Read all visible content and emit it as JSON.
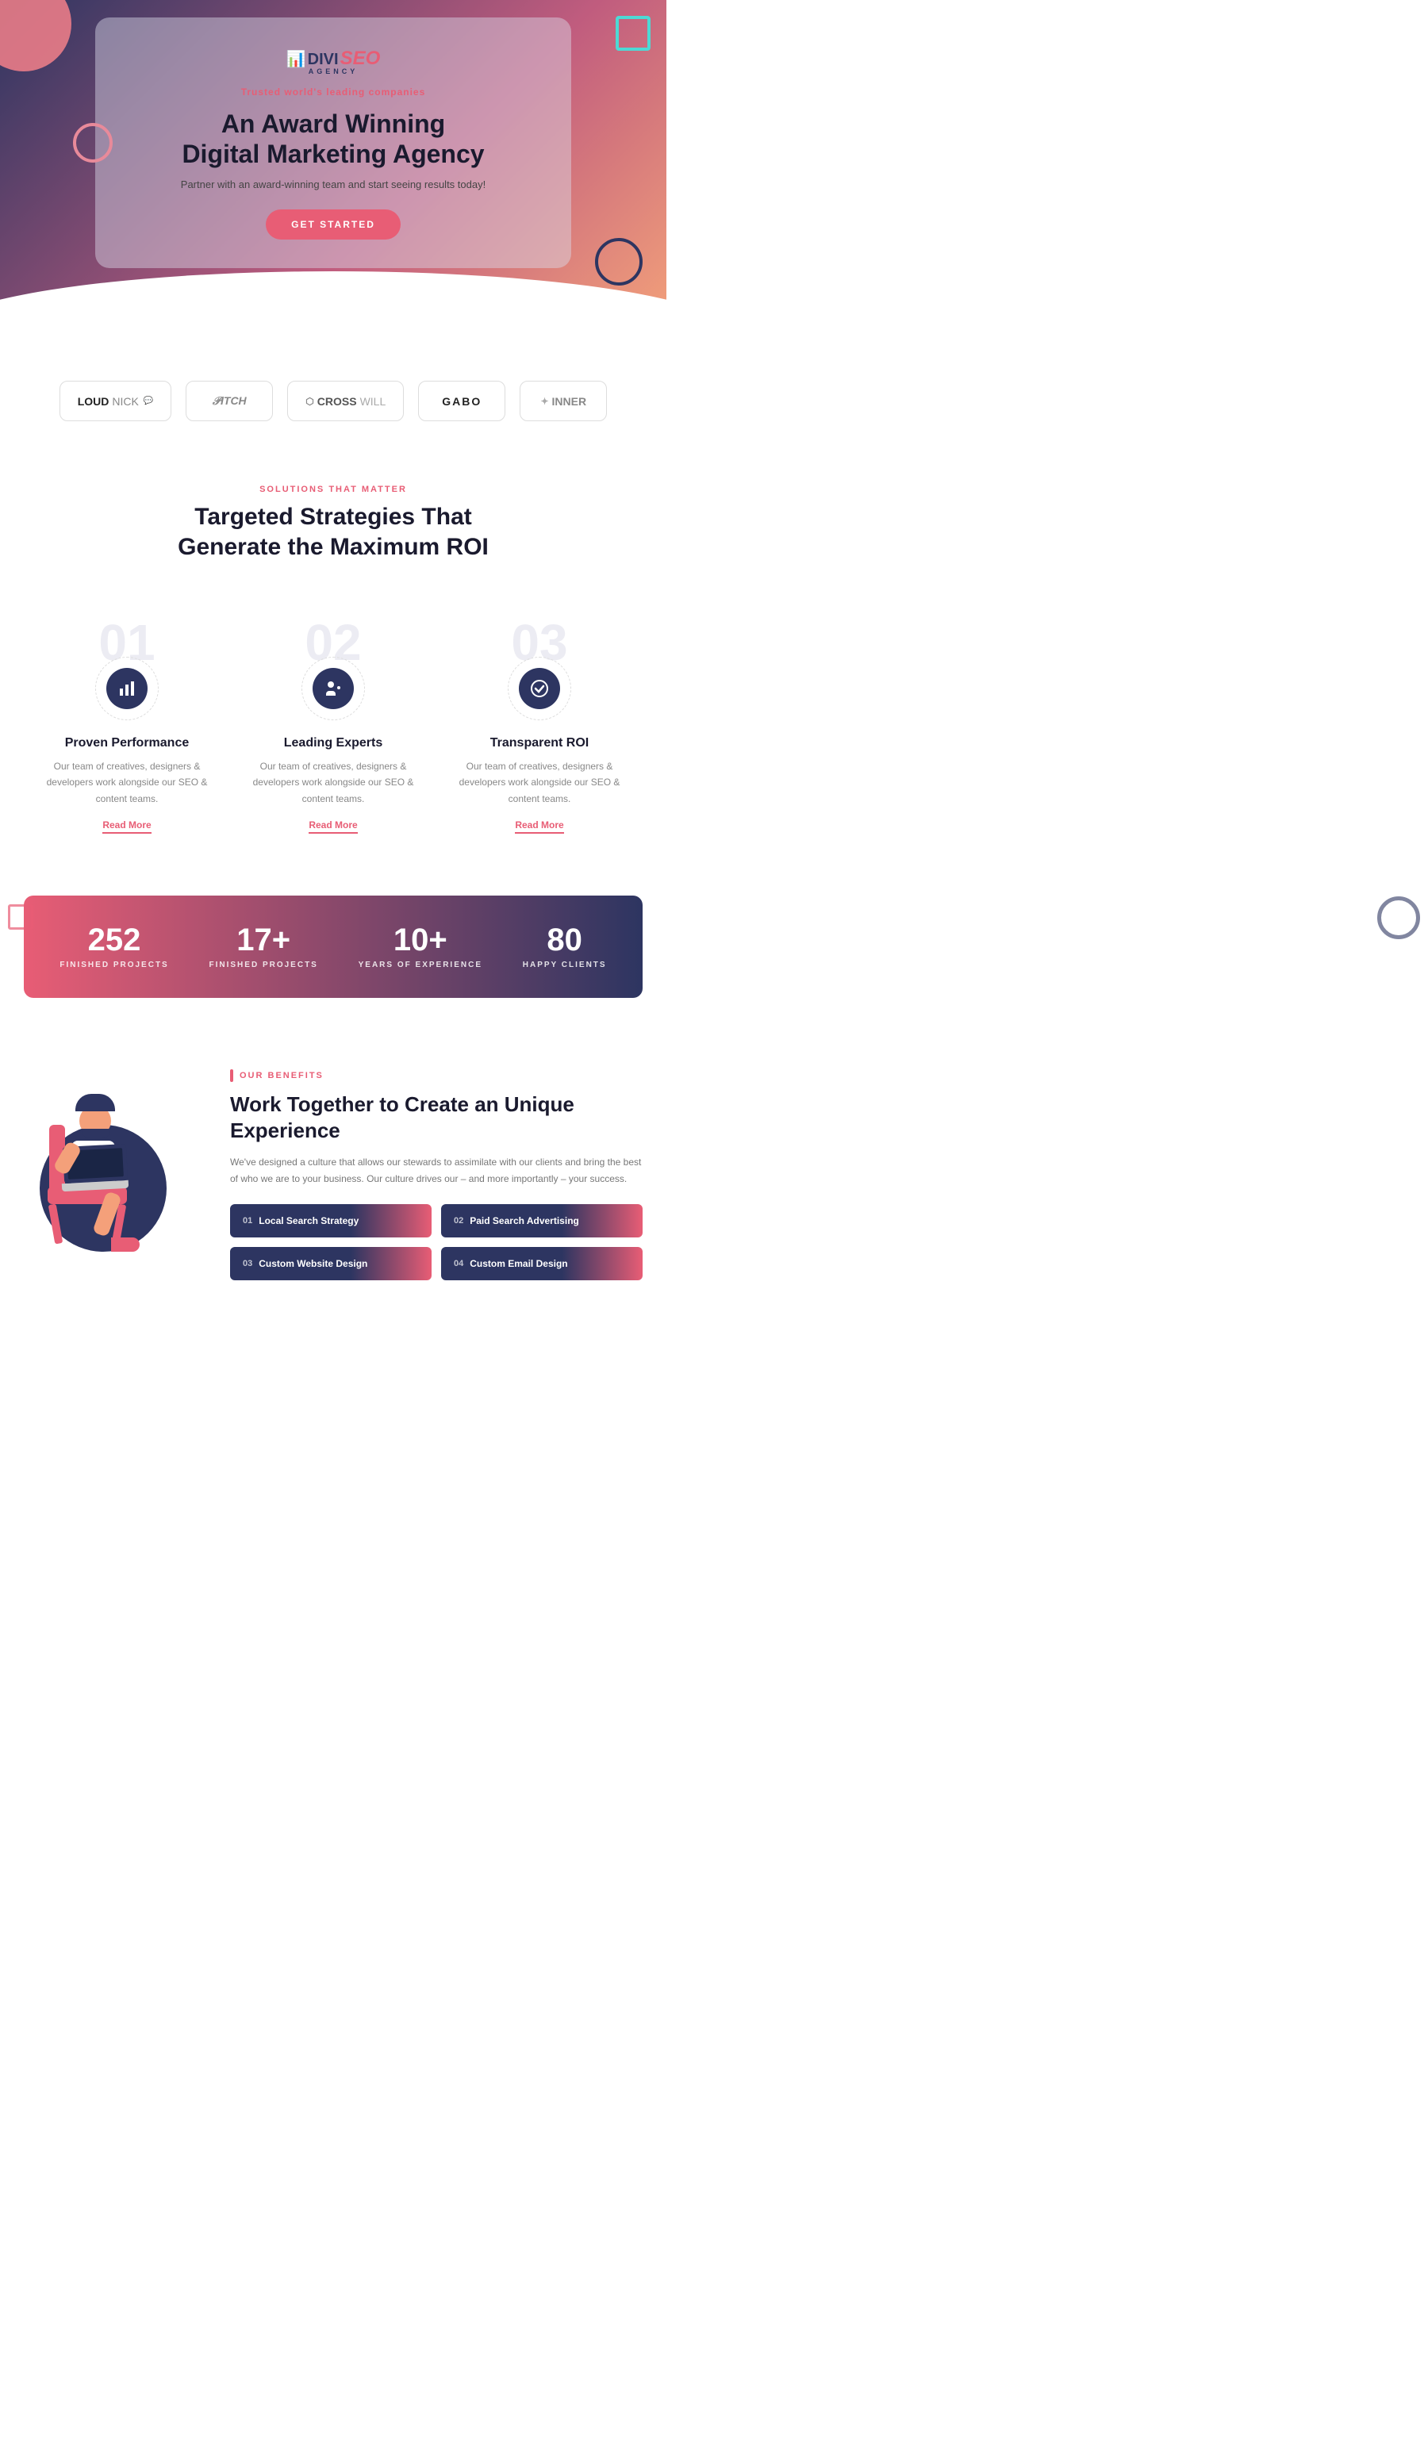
{
  "hero": {
    "tagline": "Trusted world's leading companies",
    "title_line1": "An Award Winning",
    "title_line2": "Digital Marketing Agency",
    "subtitle": "Partner with an award-winning team and start seeing results today!",
    "cta_label": "GET STARTED",
    "logo_divi": "DIVI",
    "logo_seo": "SEO",
    "logo_agency": "AGENCY"
  },
  "clients": [
    {
      "name": "LOUDNICK",
      "bold": "LOUD",
      "light": "NICK"
    },
    {
      "name": "PITCH",
      "display": "𝒫ITCH"
    },
    {
      "name": "CROSSWILL",
      "display": "⬡ CROSSWILL"
    },
    {
      "name": "GABO",
      "display": "GABO"
    },
    {
      "name": "INNER",
      "display": "✦ INNER"
    }
  ],
  "solutions": {
    "label": "SOLUTIONS THAT MATTER",
    "title_line1": "Targeted Strategies That",
    "title_line2": "Generate the Maximum ROI"
  },
  "features": [
    {
      "number": "01",
      "icon": "bar-chart",
      "title": "Proven Performance",
      "desc": "Our team of creatives, designers & developers work alongside our SEO & content teams.",
      "link": "Read More"
    },
    {
      "number": "02",
      "icon": "user-settings",
      "title": "Leading Experts",
      "desc": "Our team of creatives, designers & developers work alongside our SEO & content teams.",
      "link": "Read More"
    },
    {
      "number": "03",
      "icon": "check",
      "title": "Transparent ROI",
      "desc": "Our team of creatives, designers & developers work alongside our SEO & content teams.",
      "link": "Read More"
    }
  ],
  "stats": [
    {
      "number": "252",
      "label": "FINISHED PROJECTS"
    },
    {
      "number": "17+",
      "label": "FINISHED PROJECTS"
    },
    {
      "number": "10+",
      "label": "YEARS OF EXPERIENCE"
    },
    {
      "number": "80",
      "label": "HAPPY CLIENTS"
    }
  ],
  "benefits": {
    "label": "OUR BENEFITS",
    "title_line1": "Work Together to Create an Unique",
    "title_line2": "Experience",
    "desc": "We've designed a culture that allows our stewards to assimilate with our clients and bring the best of who we are to your business. Our culture drives our – and more importantly – your success.",
    "items": [
      {
        "num": "01",
        "label": "Local Search Strategy"
      },
      {
        "num": "02",
        "label": "Paid Search Advertising"
      },
      {
        "num": "03",
        "label": "Custom Website Design"
      },
      {
        "num": "04",
        "label": "Custom Email Design"
      }
    ]
  }
}
